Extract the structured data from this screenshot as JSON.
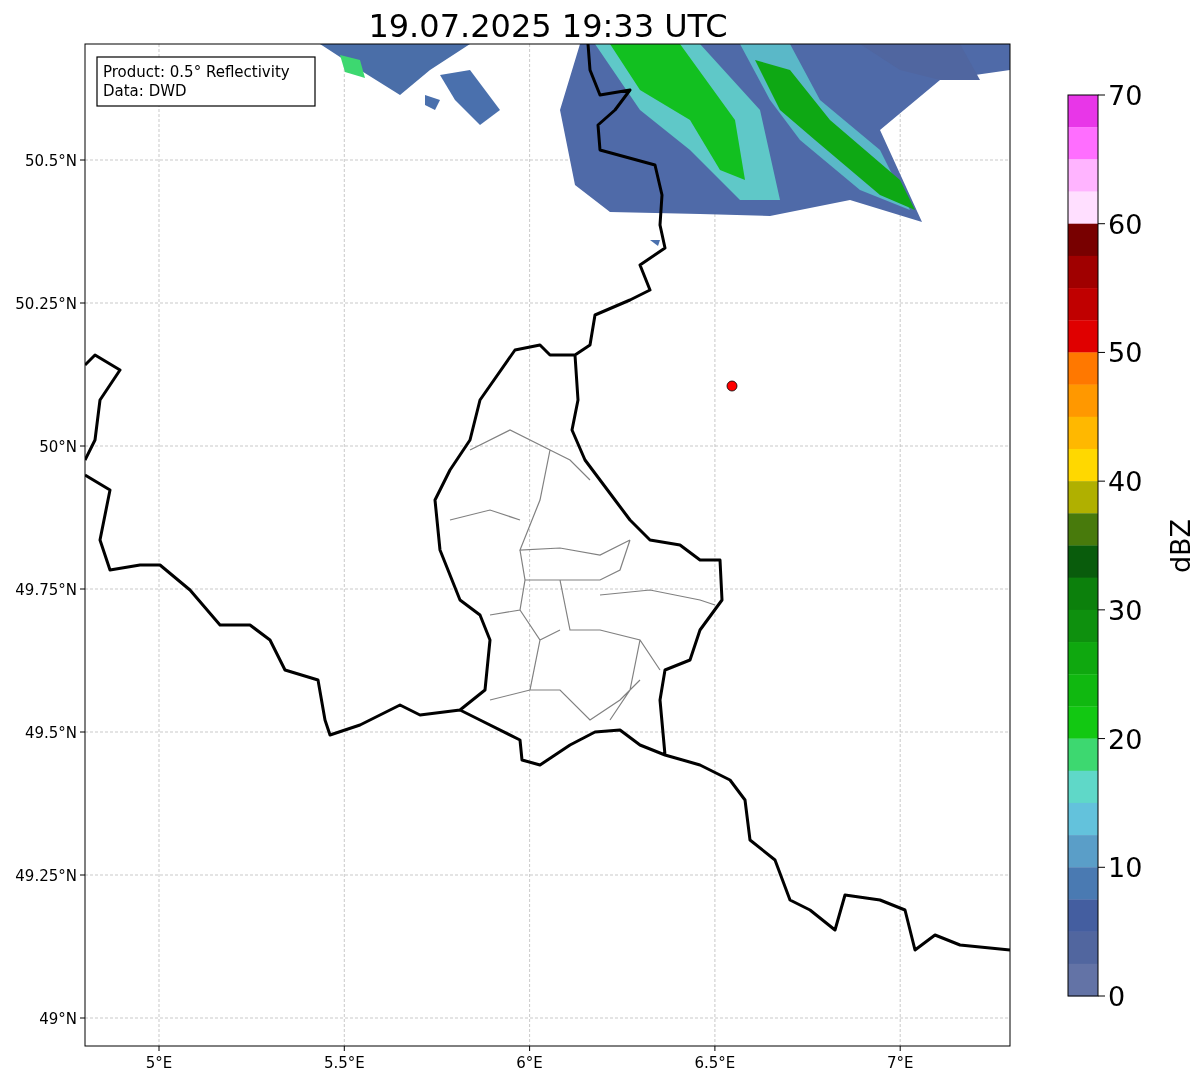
{
  "title": "19.07.2025 19:33 UTC",
  "info_box": [
    "Product: 0.5° Reflectivity",
    "Data: DWD"
  ],
  "lat_labels": [
    "50.5°N",
    "50.25°N",
    "50°N",
    "49.75°N",
    "49.5°N",
    "49.25°N",
    "49°N"
  ],
  "lon_labels": [
    "5°E",
    "5.5°E",
    "6°E",
    "6.5°E",
    "7°E"
  ],
  "colorbar": {
    "label": "dBZ",
    "ticks": [
      "70",
      "60",
      "50",
      "40",
      "30",
      "20",
      "10",
      "0"
    ],
    "bins": [
      {
        "color": "#e836e8"
      },
      {
        "color": "#ff6eff"
      },
      {
        "color": "#ffb4ff"
      },
      {
        "color": "#ffdfff"
      },
      {
        "color": "#780000"
      },
      {
        "color": "#a00000"
      },
      {
        "color": "#c00000"
      },
      {
        "color": "#e00000"
      },
      {
        "color": "#ff7800"
      },
      {
        "color": "#ff9800"
      },
      {
        "color": "#ffb800"
      },
      {
        "color": "#ffd800"
      },
      {
        "color": "#b0b000"
      },
      {
        "color": "#487a0c"
      },
      {
        "color": "#095c0c"
      },
      {
        "color": "#0c800c"
      },
      {
        "color": "#0e900e"
      },
      {
        "color": "#0fa80f"
      },
      {
        "color": "#10b810"
      },
      {
        "color": "#12c812"
      },
      {
        "color": "#3dd870"
      },
      {
        "color": "#5fd8c8"
      },
      {
        "color": "#63c2dc"
      },
      {
        "color": "#5a9ec8"
      },
      {
        "color": "#4a7ab2"
      },
      {
        "color": "#445ea0"
      },
      {
        "color": "#51669f"
      },
      {
        "color": "#6373a6"
      }
    ]
  }
}
